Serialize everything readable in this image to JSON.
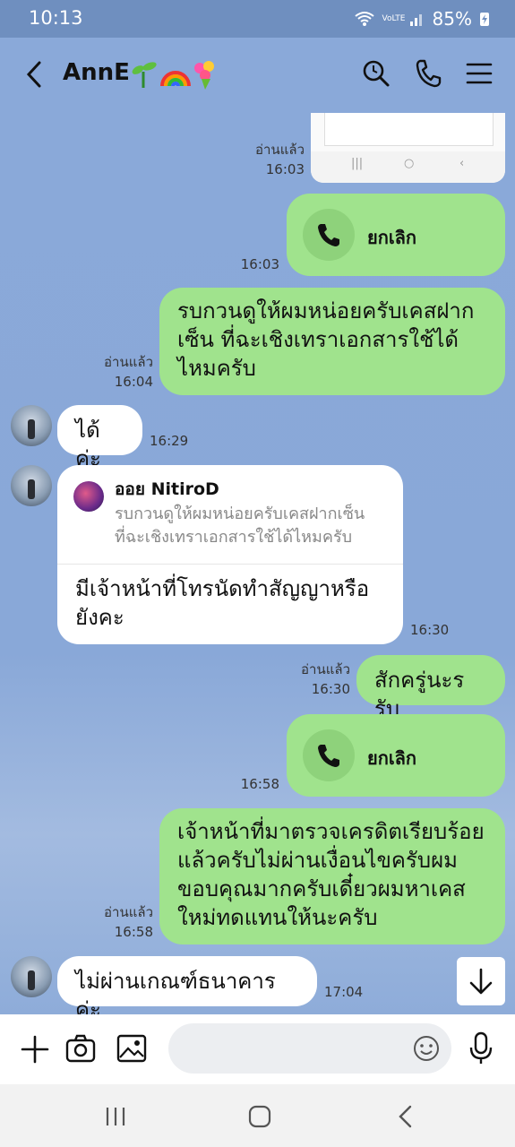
{
  "status": {
    "time": "10:13",
    "battery": "85%",
    "network": "VoLTE"
  },
  "header": {
    "title": "AnnE",
    "icons": [
      "back-arrow-icon",
      "search-icon",
      "phone-icon",
      "menu-icon"
    ],
    "emoji": [
      "seedling-emoji",
      "rainbow-emoji",
      "bouquet-emoji"
    ]
  },
  "messages": {
    "m0": {
      "read": "อ่านแล้ว",
      "time": "16:03"
    },
    "m1": {
      "call_label": "ยกเลิก",
      "time": "16:03"
    },
    "m2": {
      "text": [
        "รบกวนดูให้ผมหน่อยครับเคสฝาก",
        "เซ็น ที่ฉะเชิงเทราเอกสารใช้ได้",
        "ไหมครับ"
      ],
      "read": "อ่านแล้ว",
      "time": "16:04"
    },
    "m3": {
      "text": "ได้ค่ะ",
      "time": "16:29"
    },
    "m4": {
      "reply_name": "ออย NitiroD",
      "reply_text": [
        "รบกวนดูให้ผมหน่อยครับเคสฝากเซ็น",
        "ที่ฉะเชิงเทราเอกสารใช้ได้ไหมครับ"
      ],
      "text": [
        "มีเจ้าหน้าที่โทรนัดทำสัญญาหรือ",
        "ยังคะ"
      ],
      "time": "16:30"
    },
    "m5": {
      "text": "สักครู่นะรรับ",
      "read": "อ่านแล้ว",
      "time": "16:30"
    },
    "m6": {
      "call_label": "ยกเลิก",
      "time": "16:58"
    },
    "m7": {
      "text": [
        "เจ้าหน้าที่มาตรวจเครดิตเรียบร้อย",
        "แล้วครับไม่ผ่านเงื่อนไขครับผม",
        "ขอบคุณมากครับเดี๋ยวผมหาเคส",
        "ใหม่ทดแทนให้นะครับ"
      ],
      "read": "อ่านแล้ว",
      "time": "16:58"
    },
    "m8": {
      "text": "ไม่ผ่านเกณฑ์ธนาคารค่ะ",
      "time": "17:04"
    }
  },
  "colors": {
    "chat_bg": "#8aa9d9",
    "my_bubble": "#a0e38d",
    "their_bubble": "#ffffff",
    "status_bar": "#6f8fbf"
  }
}
